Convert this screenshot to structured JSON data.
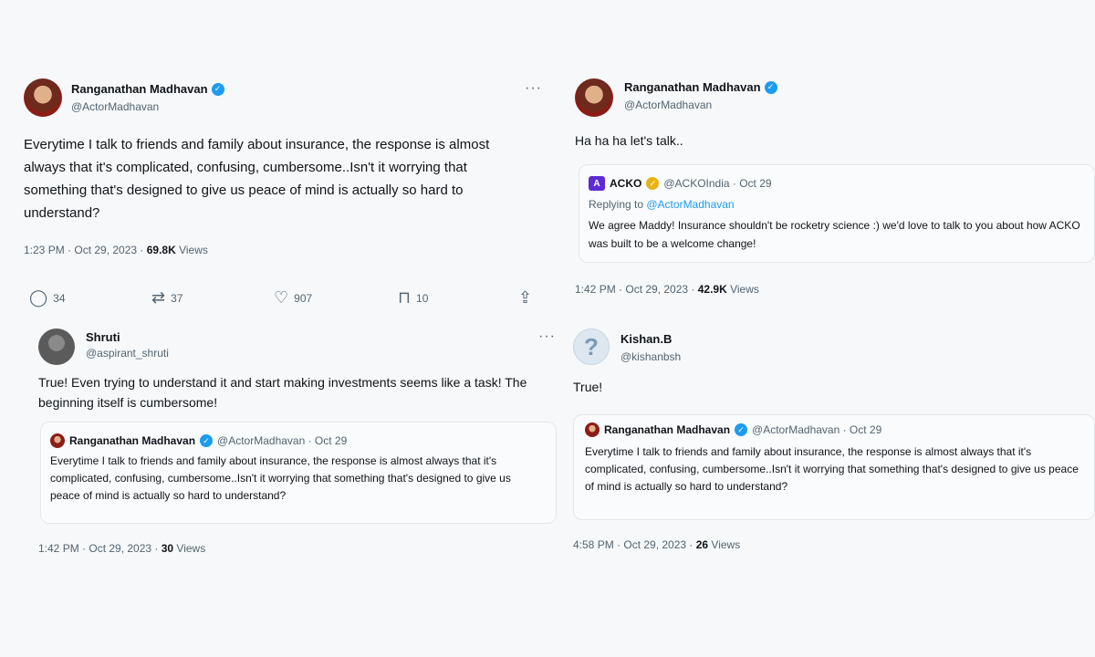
{
  "tweets": {
    "left_main": {
      "name": "Ranganathan Madhavan",
      "handle": "@ActorMadhavan",
      "text": "Everytime I talk to friends and family about insurance, the response is almost always that it's complicated, confusing, cumbersome..Isn't it worrying that something that's designed to give us peace of mind is actually so hard to understand?",
      "time": "1:23 PM · Oct 29, 2023 · ",
      "views_count": "69.8K",
      "views_label": " Views",
      "replies": "34",
      "reposts": "37",
      "likes": "907",
      "bookmarks": "10"
    },
    "left_reply": {
      "name": "Shruti",
      "handle": "@aspirant_shruti",
      "text": "True! Even trying to understand it and start making investments seems like a task! The beginning itself is cumbersome!",
      "quote_name": "Ranganathan Madhavan",
      "quote_handle": "@ActorMadhavan · Oct 29",
      "quote_text": "Everytime I talk to friends and family about insurance, the response is almost always that it's complicated, confusing, cumbersome..Isn't it worrying that something that's designed to give us peace of mind is actually so hard to understand?",
      "time": "1:42 PM · Oct 29, 2023 · ",
      "views_count": "30",
      "views_label": " Views"
    },
    "right_main": {
      "name": "Ranganathan Madhavan",
      "handle": "@ActorMadhavan",
      "text": "Ha ha ha let's talk..",
      "quote_name": "ACKO",
      "quote_handle": "@ACKOIndia · Oct 29",
      "quote_reply_prefix": "Replying to ",
      "quote_reply_handle": "@ActorMadhavan",
      "quote_text": "We agree Maddy! Insurance shouldn't be rocketry science :) we'd love to talk to you about how ACKO was built to be a welcome change!",
      "time": "1:42 PM · Oct 29, 2023 · ",
      "views_count": "42.9K",
      "views_label": " Views"
    },
    "right_reply": {
      "name": "Kishan.B",
      "handle": "@kishanbsh",
      "text": "True!",
      "quote_name": "Ranganathan Madhavan",
      "quote_handle": "@ActorMadhavan · Oct 29",
      "quote_text": "Everytime I talk to friends and family about insurance, the response is almost always that it's complicated, confusing, cumbersome..Isn't it worrying that something that's designed to give us peace of mind is actually so hard to understand?",
      "time": "4:58 PM · Oct 29, 2023 · ",
      "views_count": "26",
      "views_label": " Views"
    }
  },
  "icons": {
    "verified": "✓",
    "more": "···",
    "reply": "◯",
    "repost": "⇄",
    "like": "♡",
    "bookmark": "⊓",
    "share": "⇪",
    "kishan_avatar": "?"
  },
  "colors": {
    "accent": "#1d9bf0",
    "secondary_text": "#536471",
    "background": "#f7f8f9"
  }
}
